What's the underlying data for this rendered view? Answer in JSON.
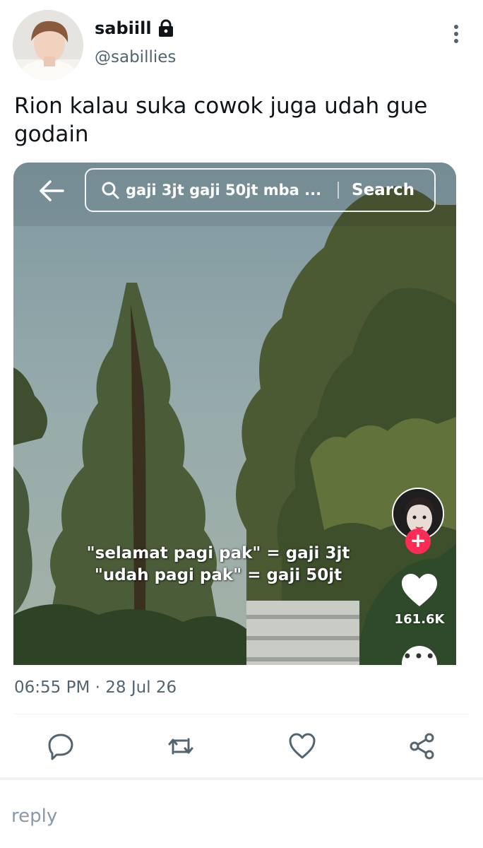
{
  "author": {
    "display_name": "sabiill",
    "handle": "@sabillies",
    "protected": true
  },
  "tweet": {
    "text": "Rion kalau suka cowok juga udah gue godain",
    "timestamp": "06:55 PM · 28 Jul 26"
  },
  "media": {
    "search_query": "gaji 3jt gaji 50jt mba ...",
    "search_button": "Search",
    "caption_line1": "\"selamat pagi pak\" = gaji 3jt",
    "caption_line2": "\"udah pagi pak\" = gaji 50jt",
    "like_count": "161.6K"
  },
  "composer": {
    "placeholder": "reply"
  },
  "colors": {
    "text_primary": "#0f1419",
    "text_secondary": "#536471",
    "tiktok_red": "#fe2c55"
  }
}
